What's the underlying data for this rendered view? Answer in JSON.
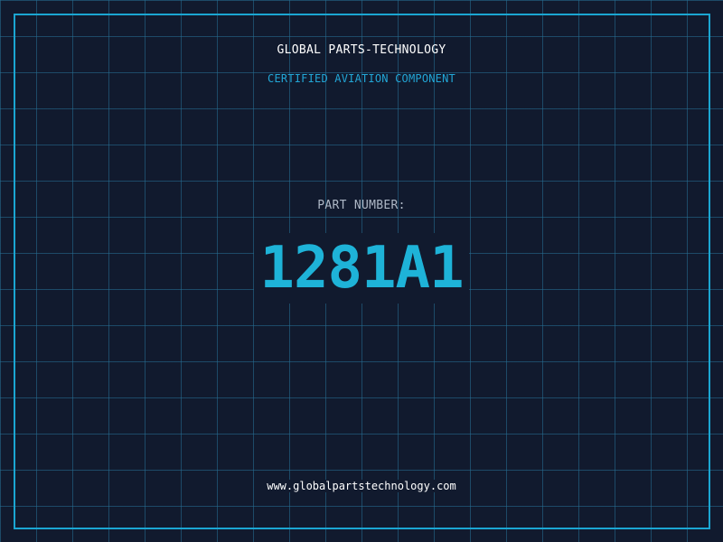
{
  "header": {
    "company": "GLOBAL PARTS-TECHNOLOGY",
    "subtitle": "CERTIFIED AVIATION COMPONENT"
  },
  "part": {
    "label": "PART NUMBER:",
    "number": "1281A1"
  },
  "footer": {
    "url": "www.globalpartstechnology.com"
  },
  "colors": {
    "background": "#111a2e",
    "grid": "#267096",
    "frame": "#1ba6d2",
    "accent": "#1eb3d8"
  }
}
